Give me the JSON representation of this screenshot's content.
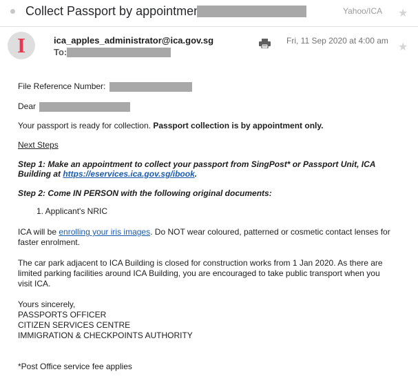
{
  "header": {
    "subject": "Collect Passport by appointment",
    "folder": "Yahoo/ICA",
    "sender": "ica_apples_administrator@ica.gov.sg",
    "to_label": "To:",
    "date": "Fri, 11 Sep 2020 at 4:00 am",
    "avatar_letter": "I"
  },
  "body": {
    "file_ref_label": "File Reference Number:",
    "dear": "Dear",
    "ready_text": "Your passport is ready for collection.",
    "ready_bold": "Passport collection is by appointment only.",
    "next_steps": "Next Steps",
    "step1_line1": "Step 1: Make an appointment to collect your passport from SingPost* or Passport Unit, ICA",
    "step1_line2_prefix": "Building at",
    "step1_link": "https://eservices.ica.gov.sg/ibook",
    "step1_suffix": ".",
    "step2": "Step 2: Come IN PERSON with the following original documents:",
    "list_item": "1. Applicant's NRIC",
    "iris_prefix": "ICA will be",
    "iris_link": "enrolling your iris images",
    "iris_suffix": ". Do NOT wear coloured, patterned or cosmetic contact lenses for",
    "iris_line2": "faster enrolment.",
    "carpark_line1": "The car park adjacent to ICA Building is closed for construction works from 1 Jan 2020. As there are",
    "carpark_line2": "limited parking facilities around ICA Building, you are encouraged to take public transport when you",
    "carpark_line3": "visit ICA.",
    "signoff": "Yours sincerely,",
    "sig1": "PASSPORTS OFFICER",
    "sig2": "CITIZEN SERVICES CENTRE",
    "sig3": "IMMIGRATION & CHECKPOINTS AUTHORITY",
    "footnote": "*Post Office service fee applies"
  },
  "icons": {
    "status_dot": "unread-dot-icon",
    "star": "star-icon",
    "print": "print-icon"
  },
  "colors": {
    "link": "#1a5baf",
    "avatar_letter": "#e8384f",
    "redaction": "#a8a8a8"
  }
}
